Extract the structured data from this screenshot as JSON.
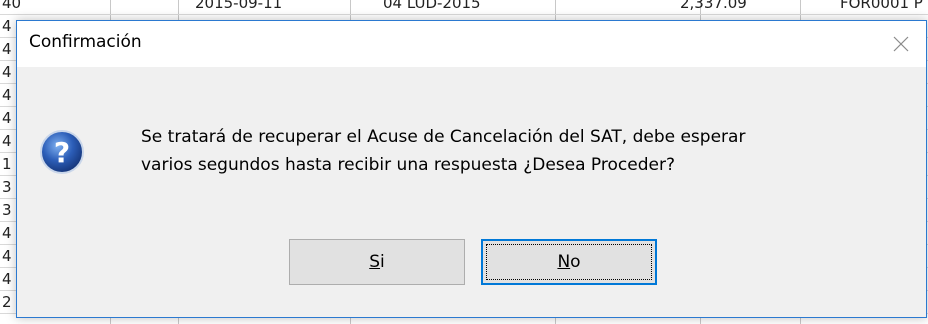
{
  "background_grid": {
    "rows": [
      {
        "c1": "40",
        "c2": "2015-09-11",
        "c3": "04 LUD-2015",
        "c4": "2,337.09",
        "c5": "FOR0001 P"
      },
      {
        "c1": "4",
        "c2": "",
        "c3": "",
        "c4": "",
        "c5": ""
      },
      {
        "c1": "4",
        "c2": "",
        "c3": "",
        "c4": "",
        "c5": ""
      },
      {
        "c1": "4",
        "c2": "",
        "c3": "",
        "c4": "",
        "c5": ""
      },
      {
        "c1": "4",
        "c2": "",
        "c3": "",
        "c4": "",
        "c5": ""
      },
      {
        "c1": "4",
        "c2": "",
        "c3": "",
        "c4": "",
        "c5": ""
      },
      {
        "c1": "4",
        "c2": "",
        "c3": "",
        "c4": "",
        "c5": ""
      },
      {
        "c1": "1",
        "c2": "",
        "c3": "",
        "c4": "",
        "c5": ""
      },
      {
        "c1": "3",
        "c2": "",
        "c3": "",
        "c4": "",
        "c5": ""
      },
      {
        "c1": "3",
        "c2": "",
        "c3": "",
        "c4": "",
        "c5": ""
      },
      {
        "c1": "4",
        "c2": "",
        "c3": "",
        "c4": "",
        "c5": ""
      },
      {
        "c1": "4",
        "c2": "",
        "c3": "",
        "c4": "",
        "c5": ""
      },
      {
        "c1": "4",
        "c2": "",
        "c3": "",
        "c4": "",
        "c5": ""
      },
      {
        "c1": "2",
        "c2": "",
        "c3": "",
        "c4": "",
        "c5": ""
      }
    ]
  },
  "dialog": {
    "title": "Confirmación",
    "message_line1": "Se tratará de recuperar el Acuse de Cancelación del SAT, debe esperar",
    "message_line2": "varios segundos hasta recibir una respuesta ¿Desea Proceder?",
    "icon": "question-icon",
    "buttons": {
      "yes_label_prefix": "S",
      "yes_label_rest": "i",
      "no_label_prefix": "N",
      "no_label_rest": "o"
    },
    "focused_button": "No"
  },
  "colors": {
    "dialog_border": "#2b79d0",
    "focus_border": "#0078d7",
    "icon_blue": "#2c5eb8"
  }
}
